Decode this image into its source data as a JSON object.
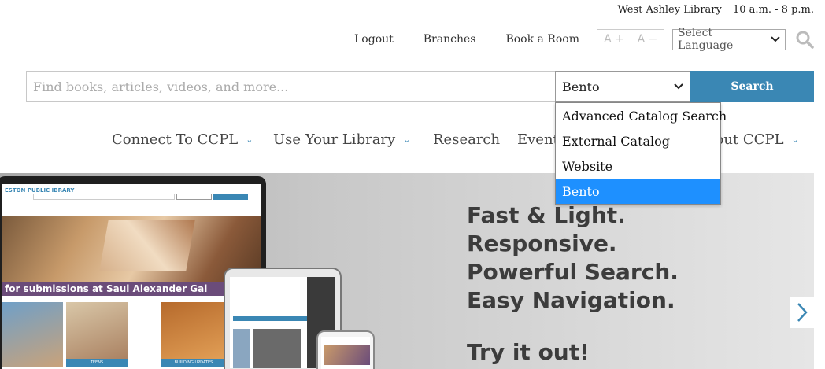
{
  "branch": {
    "name": "West Ashley Library",
    "hours": "10 a.m. - 8 p.m."
  },
  "utility": {
    "logout": "Logout",
    "branches": "Branches",
    "book_room": "Book a Room",
    "font_increase": "A +",
    "font_decrease": "A −",
    "language": "Select Language",
    "search_icon": "search-icon"
  },
  "search": {
    "placeholder": "Find books, articles, videos, and more...",
    "scope_value": "Bento",
    "button": "Search",
    "options": [
      "Advanced Catalog Search",
      "External Catalog",
      "Website",
      "Bento"
    ],
    "selected_index": 3
  },
  "nav": {
    "items": [
      {
        "label": "Connect To CCPL",
        "has_menu": true
      },
      {
        "label": "Use Your Library",
        "has_menu": true
      },
      {
        "label": "Research",
        "has_menu": false
      },
      {
        "label": "Events",
        "has_menu": false
      },
      {
        "label": "About CCPL",
        "has_menu": true
      }
    ]
  },
  "hero": {
    "lines": [
      "Fast & Light.",
      "Responsive.",
      "Powerful Search.",
      "Easy Navigation."
    ],
    "cta": "Try it out!",
    "laptop_logo": "ESTON PUBLIC IBRARY",
    "laptop_banner": "for submissions at Saul Alexander Gal",
    "tiles": [
      "TEENS",
      "BUILDING UPDATES"
    ]
  },
  "colors": {
    "accent": "#3a87b4",
    "dropdown_highlight": "#1e90ff"
  }
}
